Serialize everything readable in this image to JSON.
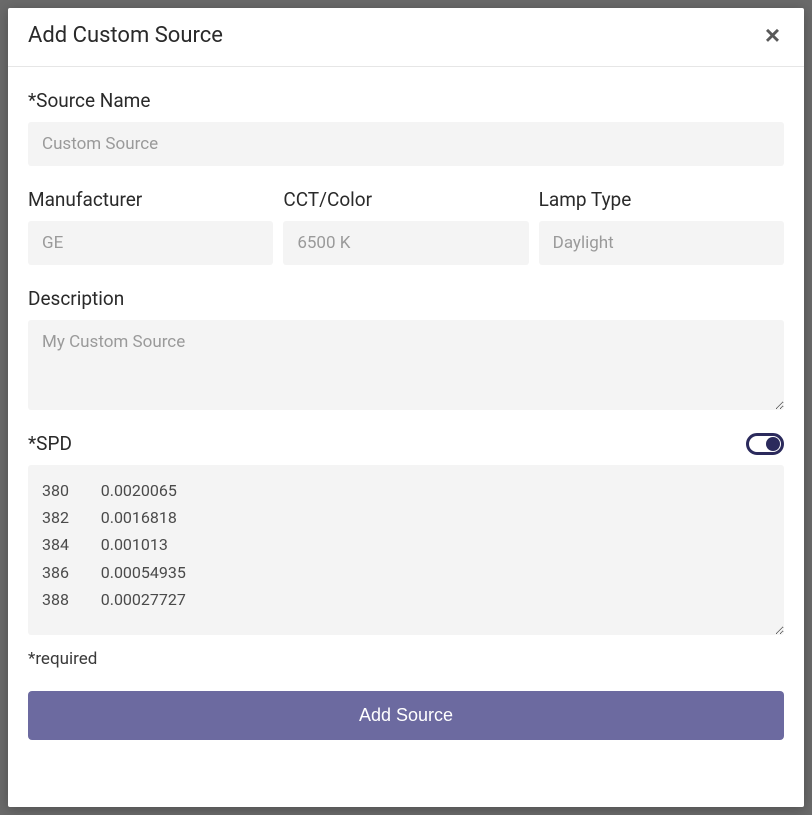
{
  "modal": {
    "title": "Add Custom Source",
    "close_label": "×"
  },
  "fields": {
    "source_name": {
      "label": "*Source Name",
      "placeholder": "Custom Source",
      "value": ""
    },
    "manufacturer": {
      "label": "Manufacturer",
      "placeholder": "GE",
      "value": ""
    },
    "cct": {
      "label": "CCT/Color",
      "placeholder": "6500 K",
      "value": ""
    },
    "lamp_type": {
      "label": "Lamp Type",
      "placeholder": "Daylight",
      "value": ""
    },
    "description": {
      "label": "Description",
      "placeholder": "My Custom Source",
      "value": ""
    },
    "spd": {
      "label": "*SPD",
      "value": "380        0.0020065\n382        0.0016818\n384        0.001013\n386        0.00054935\n388        0.00027727"
    }
  },
  "footer": {
    "required_note": "*required",
    "submit_label": "Add Source"
  }
}
